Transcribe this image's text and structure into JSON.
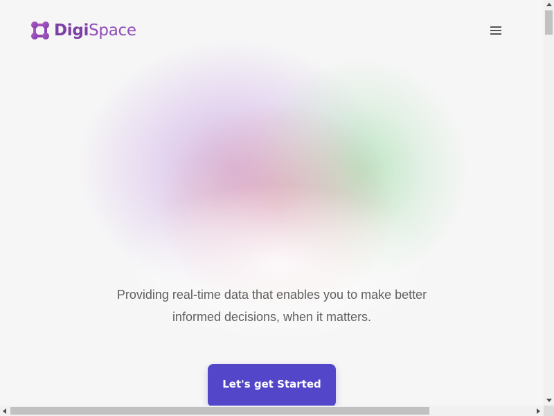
{
  "header": {
    "logo": {
      "name_part1": "Digi",
      "name_part2": "Space",
      "icon": "logo-mark-icon"
    },
    "menu": {
      "icon": "hamburger-menu-icon"
    }
  },
  "hero": {
    "tagline_line1": "Providing real-time data that enables you to make better",
    "tagline_line2": "informed decisions, when it matters.",
    "cta_label": "Let's get Started"
  },
  "colors": {
    "brand_purple": "#7b3fa6",
    "cta_background": "#5346c9",
    "page_background": "#f6f6f6",
    "text_gray": "#5f5f5f"
  }
}
